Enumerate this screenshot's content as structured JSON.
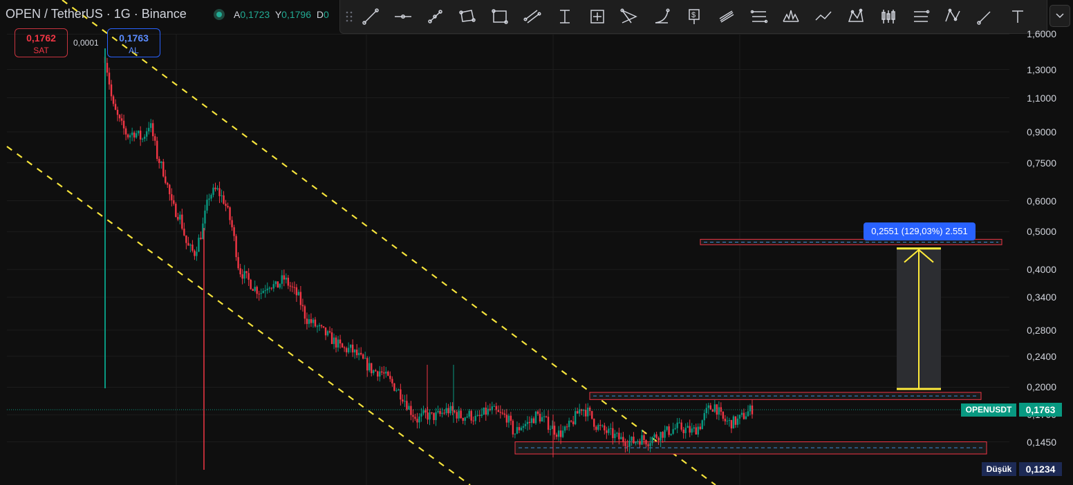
{
  "header": {
    "title": "OPEN / TetherUS · 1G · Binance",
    "ohlc": [
      {
        "key": "A",
        "value": "0,1723"
      },
      {
        "key": "Y",
        "value": "0,1796"
      },
      {
        "key": "D",
        "value": "0"
      }
    ]
  },
  "orders": {
    "sell_price": "0,1762",
    "sell_label": "SAT",
    "spread": "0,0001",
    "buy_price": "0,1763",
    "buy_label": "AL"
  },
  "toolbar": {
    "tools": [
      "trend-line",
      "horizontal-ray",
      "info-line",
      "rectangle-rotated",
      "rectangle",
      "parallel-channel",
      "price-range",
      "date-price-range",
      "pitchfork",
      "arc",
      "price-label",
      "fib-channel",
      "fib-retracement",
      "head-shoulders",
      "polyline",
      "xabcd-pattern",
      "candles-bars",
      "long-position",
      "abcd-pattern",
      "brush",
      "text"
    ]
  },
  "price_axis": {
    "labels": [
      "1,6000",
      "1,3000",
      "1,1000",
      "0,9000",
      "0,7500",
      "0,6000",
      "0,5000",
      "0,4000",
      "0,3400",
      "0,2800",
      "0,2400",
      "0,2000",
      "0,1700",
      "0,1450"
    ]
  },
  "measure": {
    "label": "0,2551 (129,03%) 2.551"
  },
  "tags": {
    "symbol": "OPENUSDT",
    "last_price": "0,1763",
    "low_label": "Düşük",
    "low_price": "0,1234"
  },
  "colors": {
    "up": "#089981",
    "down": "#f23645",
    "channel": "#f5e33b",
    "zone_border": "#f23645",
    "zone_mid": "#3b8fd9",
    "background": "#0f0f0f",
    "measure_arrow": "#ffeb3b"
  },
  "chart_data": {
    "type": "candlestick",
    "scale": "log",
    "ylim": [
      0.12,
      1.75
    ],
    "y_ticks": [
      1.6,
      1.3,
      1.1,
      0.9,
      0.75,
      0.6,
      0.5,
      0.4,
      0.34,
      0.28,
      0.24,
      0.2,
      0.17,
      0.145
    ],
    "grid": true,
    "last_price": 0.1763,
    "low": 0.1234,
    "series": [
      {
        "type": "close_path",
        "values": [
          1.4,
          1.05,
          0.95,
          0.88,
          0.9,
          0.86,
          0.95,
          0.78,
          0.7,
          0.58,
          0.55,
          0.46,
          0.44,
          0.5,
          0.62,
          0.64,
          0.6,
          0.52,
          0.4,
          0.38,
          0.36,
          0.35,
          0.37,
          0.36,
          0.38,
          0.36,
          0.34,
          0.3,
          0.29,
          0.28,
          0.27,
          0.26,
          0.25,
          0.25,
          0.24,
          0.23,
          0.22,
          0.22,
          0.21,
          0.2,
          0.19,
          0.175,
          0.165,
          0.17,
          0.168,
          0.17,
          0.175,
          0.172,
          0.168,
          0.17,
          0.165,
          0.172,
          0.175,
          0.17,
          0.168,
          0.152,
          0.16,
          0.162,
          0.17,
          0.165,
          0.158,
          0.152,
          0.155,
          0.165,
          0.178,
          0.172,
          0.16,
          0.155,
          0.152,
          0.148,
          0.146,
          0.145,
          0.148,
          0.146,
          0.15,
          0.153,
          0.155,
          0.158,
          0.156,
          0.154,
          0.16,
          0.175,
          0.18,
          0.165,
          0.162,
          0.164,
          0.17,
          0.1763
        ]
      }
    ],
    "zones": [
      {
        "name": "upper-target",
        "top": 0.478,
        "bottom": 0.463,
        "mid": 0.47
      },
      {
        "name": "resistance",
        "top": 0.194,
        "bottom": 0.186,
        "mid": 0.19
      },
      {
        "name": "support",
        "top": 0.145,
        "bottom": 0.135,
        "mid": 0.14
      }
    ],
    "measure": {
      "from": 0.198,
      "to": 0.453,
      "change": 0.2551,
      "percent": "129,03%"
    }
  }
}
